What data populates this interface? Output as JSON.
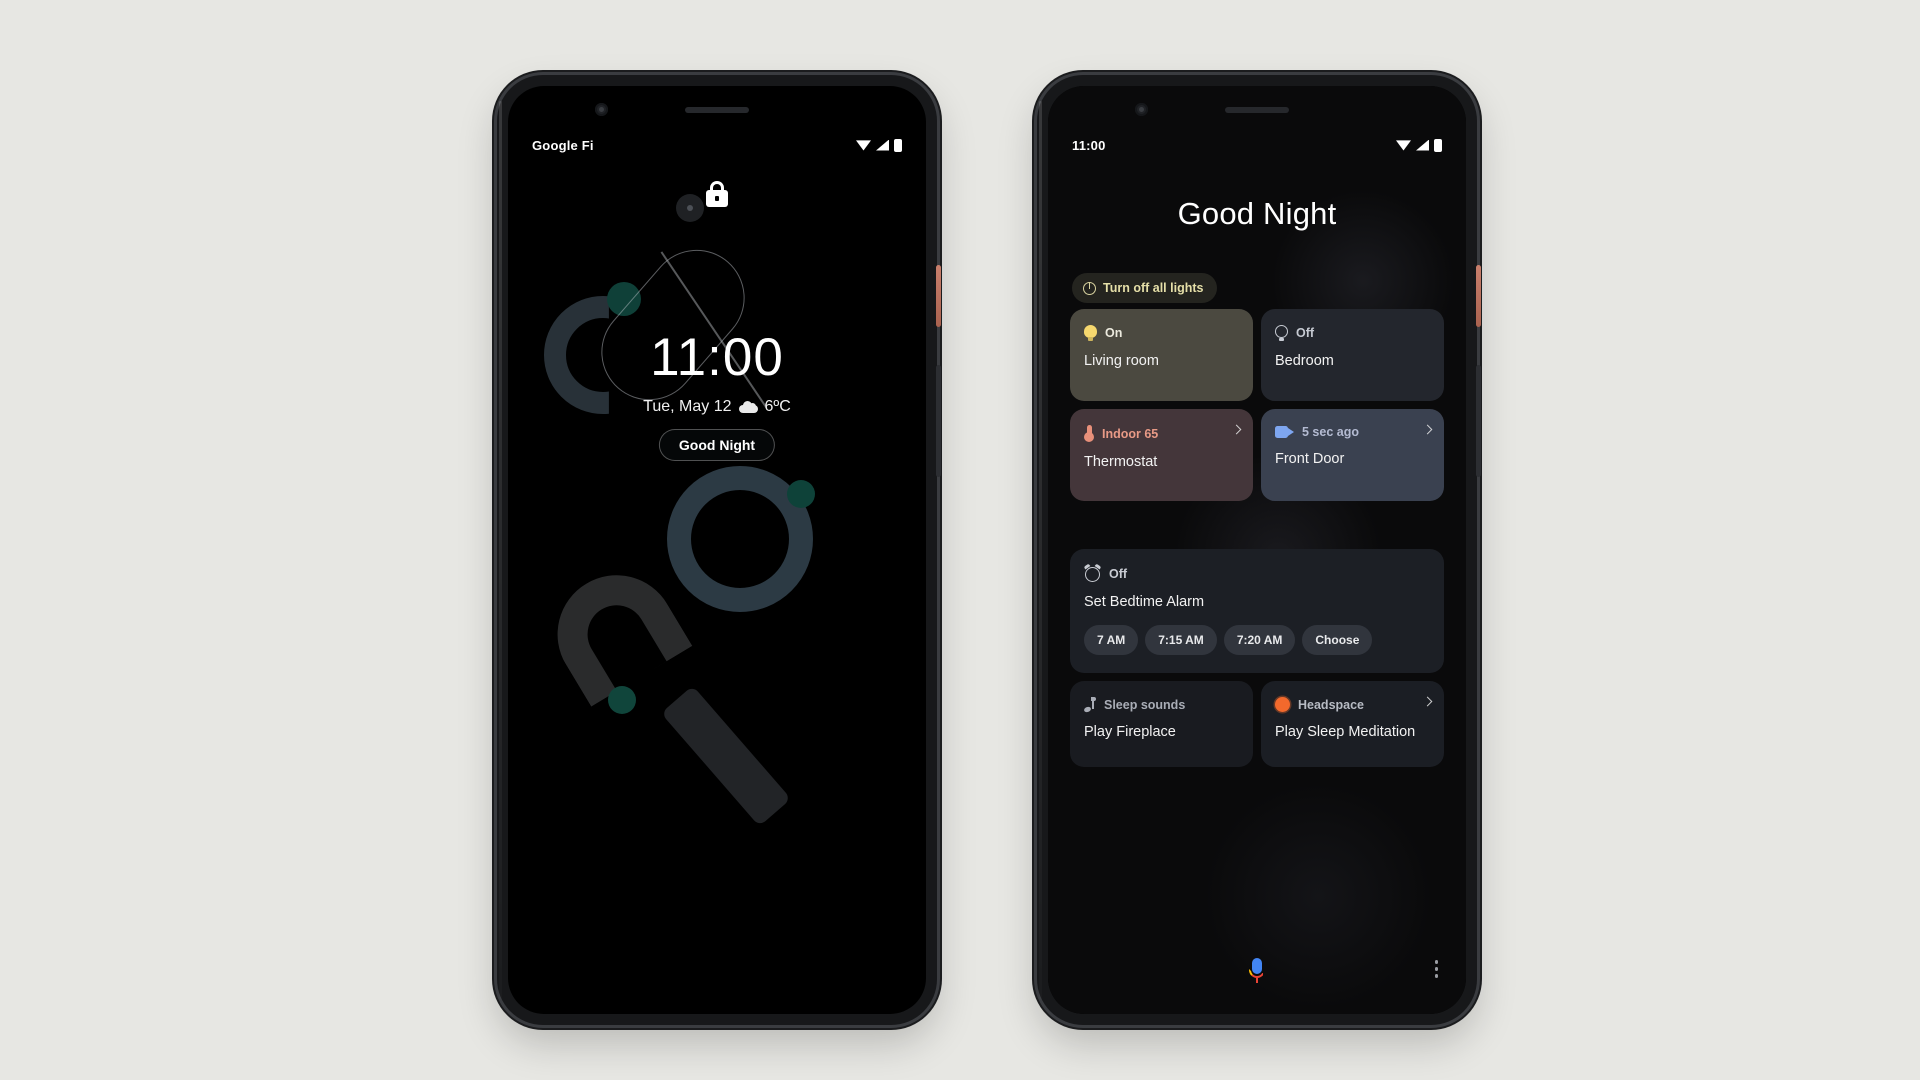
{
  "page": {
    "background_color": "#e7e7e3"
  },
  "lock_screen": {
    "status_bar": {
      "carrier": "Google Fi",
      "icons": [
        "wifi-icon",
        "signal-icon",
        "battery-icon"
      ]
    },
    "lock_icon": "lock-icon",
    "clock": {
      "time": "11:00",
      "date": "Tue, May 12",
      "weather_icon": "cloud-icon",
      "temperature": "6ºC"
    },
    "suggestion_chip": {
      "label": "Good Night"
    }
  },
  "routine_screen": {
    "status_bar": {
      "time": "11:00",
      "icons": [
        "wifi-icon",
        "signal-icon",
        "battery-icon"
      ]
    },
    "title": "Good Night",
    "lights_chip": {
      "icon": "power-icon",
      "label": "Turn off all lights",
      "text_color": "#e5dfa8",
      "background_color": "#24241f"
    },
    "cards": [
      {
        "icon": "bulb-on-icon",
        "status": "On",
        "title": "Living room",
        "background_color": "#4b4940",
        "has_chevron": false
      },
      {
        "icon": "bulb-off-icon",
        "status": "Off",
        "title": "Bedroom",
        "background_color": "#23262d",
        "has_chevron": false
      },
      {
        "icon": "thermometer-icon",
        "status": "Indoor 65",
        "title": "Thermostat",
        "background_color": "#44363a",
        "has_chevron": true
      },
      {
        "icon": "camera-icon",
        "status": "5 sec ago",
        "title": "Front Door",
        "background_color": "#3a4150",
        "has_chevron": true
      }
    ],
    "alarm_card": {
      "icon": "alarm-clock-icon",
      "status": "Off",
      "title": "Set Bedtime Alarm",
      "background_color": "#1c1f25",
      "options": [
        "7 AM",
        "7:15 AM",
        "7:20 AM",
        "Choose"
      ]
    },
    "media_cards": [
      {
        "icon": "music-note-icon",
        "status": "Sleep sounds",
        "title": "Play Fireplace",
        "background_color": "#191b20",
        "has_chevron": false
      },
      {
        "icon": "headspace-icon",
        "status": "Headspace",
        "title": "Play Sleep Meditation",
        "background_color": "#1b1e24",
        "has_chevron": true,
        "icon_color": "#f2692c"
      }
    ],
    "nav_bar": {
      "assistant_icon": "google-assistant-mic-icon",
      "overflow_icon": "more-vertical-icon"
    }
  }
}
